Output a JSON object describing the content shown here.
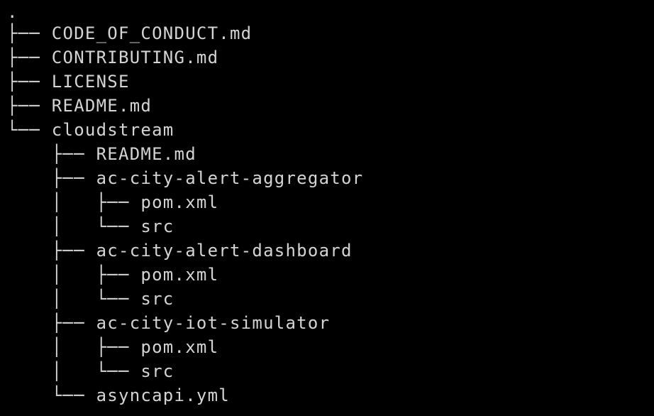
{
  "terminal": {
    "root": ".",
    "lines": [
      {
        "prefix": "├── ",
        "name": "CODE_OF_CONDUCT.md"
      },
      {
        "prefix": "├── ",
        "name": "CONTRIBUTING.md"
      },
      {
        "prefix": "├── ",
        "name": "LICENSE"
      },
      {
        "prefix": "├── ",
        "name": "README.md"
      },
      {
        "prefix": "└── ",
        "name": "cloudstream"
      },
      {
        "prefix": "    ├── ",
        "name": "README.md"
      },
      {
        "prefix": "    ├── ",
        "name": "ac-city-alert-aggregator"
      },
      {
        "prefix": "    │   ├── ",
        "name": "pom.xml"
      },
      {
        "prefix": "    │   └── ",
        "name": "src"
      },
      {
        "prefix": "    ├── ",
        "name": "ac-city-alert-dashboard"
      },
      {
        "prefix": "    │   ├── ",
        "name": "pom.xml"
      },
      {
        "prefix": "    │   └── ",
        "name": "src"
      },
      {
        "prefix": "    ├── ",
        "name": "ac-city-iot-simulator"
      },
      {
        "prefix": "    │   ├── ",
        "name": "pom.xml"
      },
      {
        "prefix": "    │   └── ",
        "name": "src"
      },
      {
        "prefix": "    └── ",
        "name": "asyncapi.yml"
      }
    ]
  }
}
